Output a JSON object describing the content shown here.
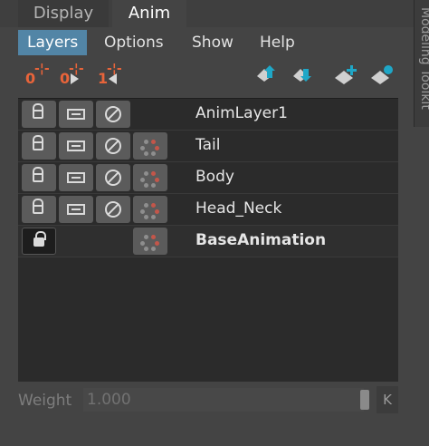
{
  "tabs": [
    {
      "label": "Display"
    },
    {
      "label": "Anim",
      "active": true
    }
  ],
  "side_panel": {
    "label": "Modeling Toolkit"
  },
  "menu": [
    {
      "label": "Layers",
      "active": true
    },
    {
      "label": "Options"
    },
    {
      "label": "Show"
    },
    {
      "label": "Help"
    }
  ],
  "toolbar": {
    "left": [
      {
        "num": "0",
        "icon": "key-zero-icon"
      },
      {
        "num": "0",
        "icon": "key-zero-forward-icon"
      },
      {
        "num": "1",
        "icon": "key-one-back-icon"
      }
    ],
    "right": [
      {
        "icon": "move-layer-up-icon"
      },
      {
        "icon": "move-layer-down-icon"
      },
      {
        "icon": "create-layer-from-selected-icon"
      },
      {
        "icon": "create-empty-layer-icon"
      }
    ],
    "accent": "#1fa7c7"
  },
  "layers": [
    {
      "name": "AnimLayer1",
      "bold": false,
      "has_ghost": false,
      "locked": false,
      "has_solo": true,
      "has_mute": true
    },
    {
      "name": "Tail",
      "bold": false,
      "has_ghost": true,
      "locked": false,
      "has_solo": true,
      "has_mute": true
    },
    {
      "name": "Body",
      "bold": false,
      "has_ghost": true,
      "locked": false,
      "has_solo": true,
      "has_mute": true
    },
    {
      "name": "Head_Neck",
      "bold": false,
      "has_ghost": true,
      "locked": false,
      "has_solo": true,
      "has_mute": true
    },
    {
      "name": "BaseAnimation",
      "bold": true,
      "has_ghost": true,
      "locked": true,
      "has_solo": false,
      "has_mute": false
    }
  ],
  "weight": {
    "label": "Weight",
    "value": "1.000",
    "key_label": "K"
  }
}
